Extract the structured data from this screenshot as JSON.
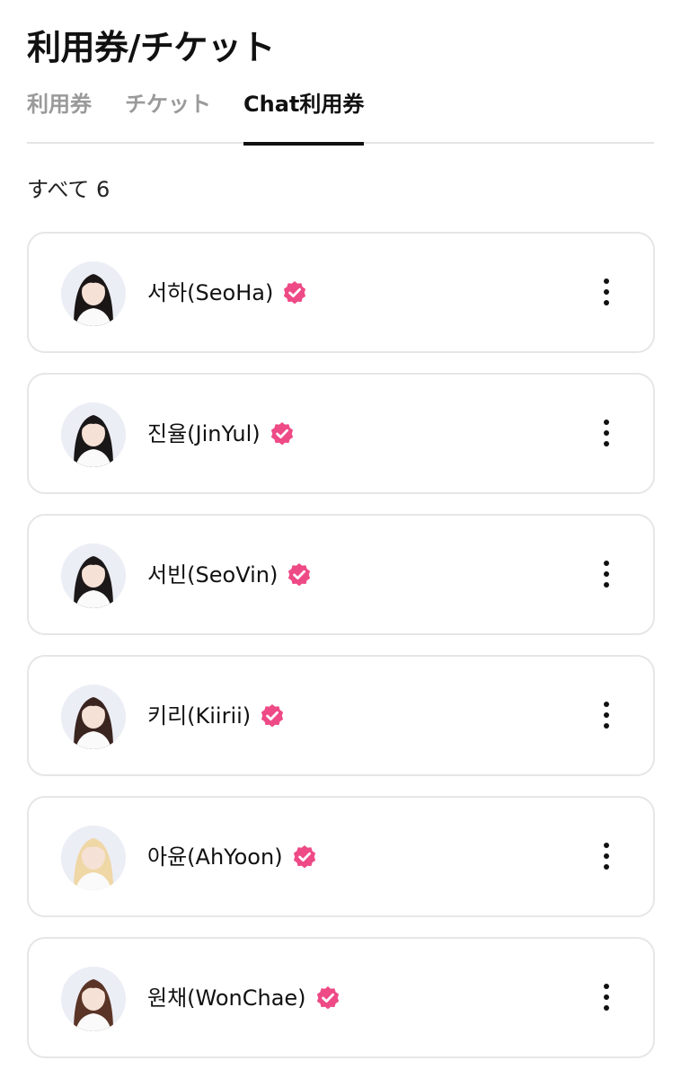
{
  "header": {
    "title": "利用券/チケット"
  },
  "tabs": [
    {
      "label": "利用券",
      "active": false
    },
    {
      "label": "チケット",
      "active": false
    },
    {
      "label": "Chat利用券",
      "active": true
    }
  ],
  "summary": {
    "count_label": "すべて 6"
  },
  "colors": {
    "verified_badge": "#ee4a86",
    "active_tab": "#111111",
    "inactive_tab": "#9a9a9a"
  },
  "items": [
    {
      "name": "서하(SeoHa)",
      "verified": true,
      "hair_color": "#1b1616"
    },
    {
      "name": "진율(JinYul)",
      "verified": true,
      "hair_color": "#1a1718"
    },
    {
      "name": "서빈(SeoVin)",
      "verified": true,
      "hair_color": "#1c1819"
    },
    {
      "name": "키리(Kiirii)",
      "verified": true,
      "hair_color": "#3a2420"
    },
    {
      "name": "아윤(AhYoon)",
      "verified": true,
      "hair_color": "#efd7a6"
    },
    {
      "name": "원채(WonChae)",
      "verified": true,
      "hair_color": "#5a3426"
    }
  ]
}
